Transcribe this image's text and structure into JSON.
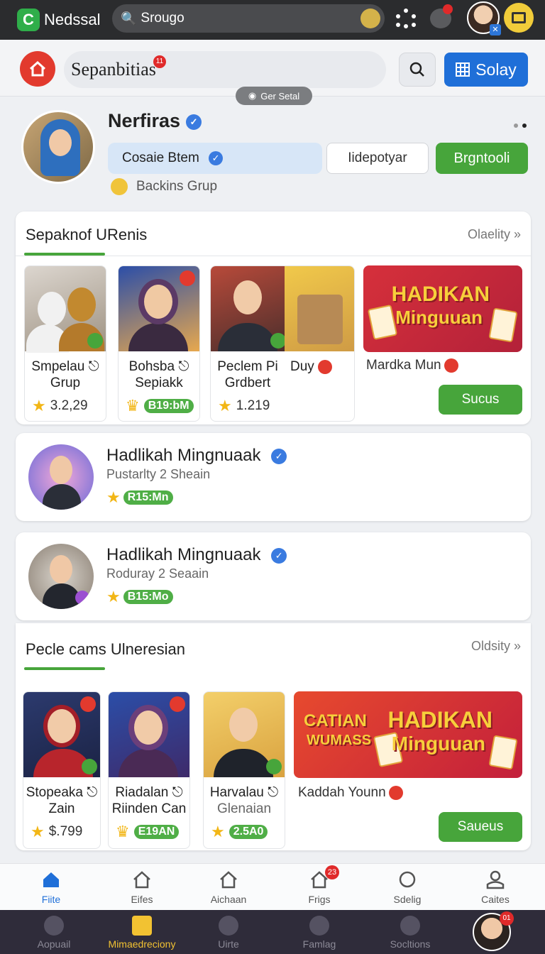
{
  "topbar": {
    "app_name": "Nedssal",
    "search_value": "Srougo"
  },
  "header": {
    "search_value": "Sepanbitias",
    "search_badge": "11",
    "primary_button": "Solay",
    "tooltip": "Ger Setal"
  },
  "profile": {
    "name": "Nerfiras",
    "chip_label": "Cosaie Btem",
    "outline_button": "Iidepotyar",
    "green_button": "Brgntooli",
    "group_label": "Backins Grup"
  },
  "section1": {
    "title": "Sepaknof URenis",
    "link": "Olaelity",
    "items": [
      {
        "title_line1": "Smpelau",
        "title_line2": "Grup",
        "rating": "3.2,29",
        "pill": ""
      },
      {
        "title_line1": "Bohsba",
        "title_line2": "Sepiakk",
        "rating": "",
        "pill": "B19:bM"
      },
      {
        "title_line1": "Peclem Pi",
        "title_line2": "Grdbert",
        "rating": "1.219",
        "pill": ""
      },
      {
        "title_line1": "Duy",
        "title_line2": "",
        "rating": "",
        "pill": ""
      }
    ],
    "promo": {
      "banner_line1": "HADIKAN",
      "banner_line2": "Minguuan",
      "title": "Mardka Mun",
      "button": "Sucus"
    }
  },
  "list": [
    {
      "title": "Hadlikah Mingnuaak",
      "subtitle": "Pustarlty 2 Sheain",
      "pill": "R15:Mn"
    },
    {
      "title": "Hadlikah Mingnuaak",
      "subtitle": "Roduray 2 Seaain",
      "pill": "B15:Mo"
    }
  ],
  "section2": {
    "title": "Pecle cams Ulneresian",
    "link": "Oldsity",
    "items": [
      {
        "title_line1": "Stopeaka",
        "title_line2": "Zain",
        "rating": "$.799",
        "pill": ""
      },
      {
        "title_line1": "Riadalan",
        "title_line2": "Riinden Can",
        "rating": "",
        "pill": "E19AN"
      },
      {
        "title_line1": "Harvalau",
        "title_line2": "Glenaian",
        "rating": "",
        "pill": "2.5A0"
      }
    ],
    "promo": {
      "banner_tag1": "CATIAN",
      "banner_tag2": "WUMASS",
      "banner_line1": "HADIKAN",
      "banner_line2": "Minguuan",
      "title": "Kaddah Younn",
      "button": "Saueus"
    }
  },
  "bottom_nav": [
    {
      "label": "Fiite",
      "active": true,
      "badge": ""
    },
    {
      "label": "Eifes",
      "active": false,
      "badge": ""
    },
    {
      "label": "Aichaan",
      "active": false,
      "badge": ""
    },
    {
      "label": "Frigs",
      "active": false,
      "badge": "23"
    },
    {
      "label": "Sdelig",
      "active": false,
      "badge": ""
    },
    {
      "label": "Caites",
      "active": false,
      "badge": ""
    }
  ],
  "system_nav": [
    {
      "label": "Aopuail"
    },
    {
      "label": "Mimaedreciony"
    },
    {
      "label": "Uirte"
    },
    {
      "label": "Famlag"
    },
    {
      "label": "Socltions"
    }
  ],
  "system_avatar_badge": "01",
  "colors": {
    "accent_blue": "#1f6fd8",
    "accent_green": "#47a53b",
    "accent_red": "#e23a2e",
    "promo_yellow": "#f7cf3b"
  }
}
